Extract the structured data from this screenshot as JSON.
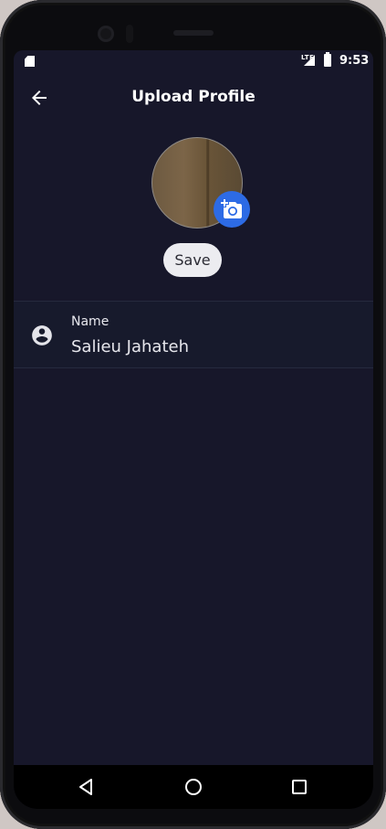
{
  "status_bar": {
    "network": "LTE",
    "time": "9:53",
    "icons": [
      "sd-card-icon",
      "signal-icon",
      "battery-icon"
    ]
  },
  "header": {
    "title": "Upload Profile",
    "back_icon": "arrow-left-icon"
  },
  "profile": {
    "photo_icon": "add-a-photo-icon",
    "save_label": "Save"
  },
  "fields": {
    "name": {
      "label": "Name",
      "value": "Salieu Jahateh",
      "icon": "account-circle-icon"
    }
  },
  "navigation_bar": {
    "buttons": [
      "back-triangle-icon",
      "home-circle-icon",
      "recent-apps-square-icon"
    ]
  },
  "colors": {
    "background": "#17172a",
    "accent": "#2d6be5",
    "save_button_bg": "#ececf0",
    "text": "#ffffff"
  }
}
